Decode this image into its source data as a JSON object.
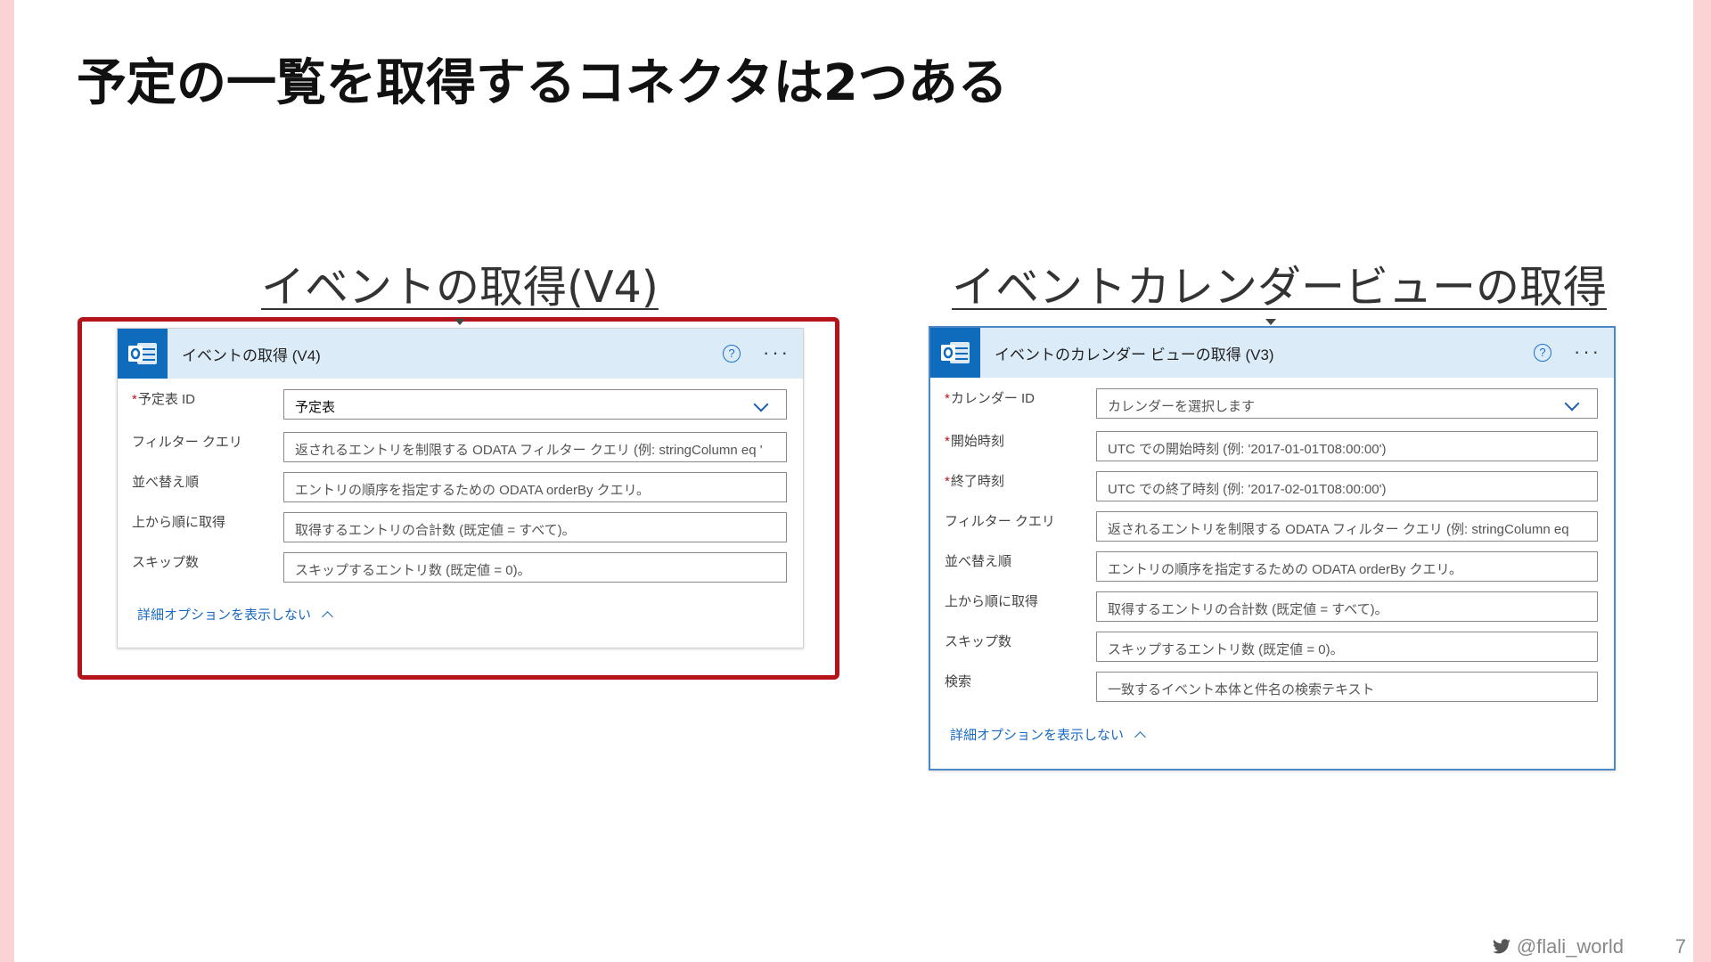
{
  "slide": {
    "title": "予定の一覧を取得するコネクタは2つある",
    "footer_handle": "@flali_world",
    "page_number": "7",
    "accent_color": "#b5131a",
    "edge_color": "#fbd3d5"
  },
  "left": {
    "heading": "イベントの取得(V4)",
    "card_title": "イベントの取得 (V4)",
    "help_glyph": "?",
    "more_glyph": "···",
    "fields": [
      {
        "label": "予定表 ID",
        "required": "*",
        "value": "予定表",
        "has_dropdown": true
      },
      {
        "label": "フィルター クエリ",
        "required": "",
        "value": "返されるエントリを制限する ODATA フィルター クエリ (例: stringColumn eq '"
      },
      {
        "label": "並べ替え順",
        "required": "",
        "value": "エントリの順序を指定するための ODATA orderBy クエリ。"
      },
      {
        "label": "上から順に取得",
        "required": "",
        "value": "取得するエントリの合計数 (既定値 = すべて)。"
      },
      {
        "label": "スキップ数",
        "required": "",
        "value": "スキップするエントリ数 (既定値 = 0)。"
      }
    ],
    "advanced_link": "詳細オプションを表示しない"
  },
  "right": {
    "heading": "イベントカレンダービューの取得",
    "card_title": "イベントのカレンダー ビューの取得 (V3)",
    "help_glyph": "?",
    "more_glyph": "···",
    "fields": [
      {
        "label": "カレンダー ID",
        "required": "*",
        "value": "カレンダーを選択します",
        "has_dropdown": true
      },
      {
        "label": "開始時刻",
        "required": "*",
        "value": "UTC での開始時刻 (例: '2017-01-01T08:00:00')"
      },
      {
        "label": "終了時刻",
        "required": "*",
        "value": "UTC での終了時刻 (例: '2017-02-01T08:00:00')"
      },
      {
        "label": "フィルター クエリ",
        "required": "",
        "value": "返されるエントリを制限する ODATA フィルター クエリ (例: stringColumn eq"
      },
      {
        "label": "並べ替え順",
        "required": "",
        "value": "エントリの順序を指定するための ODATA orderBy クエリ。"
      },
      {
        "label": "上から順に取得",
        "required": "",
        "value": "取得するエントリの合計数 (既定値 = すべて)。"
      },
      {
        "label": "スキップ数",
        "required": "",
        "value": "スキップするエントリ数 (既定値 = 0)。"
      },
      {
        "label": "検索",
        "required": "",
        "value": "一致するイベント本体と件名の検索テキスト"
      }
    ],
    "advanced_link": "詳細オプションを表示しない"
  }
}
